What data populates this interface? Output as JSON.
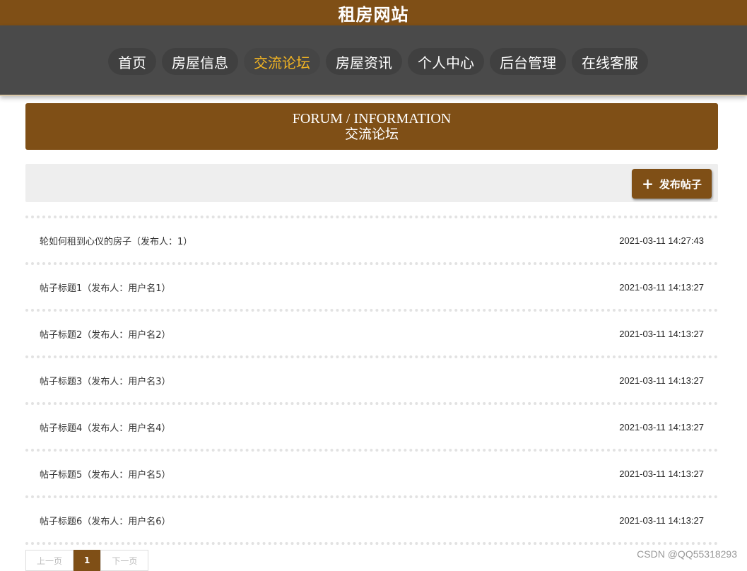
{
  "site": {
    "title": "租房网站"
  },
  "nav": {
    "items": [
      {
        "label": "首页"
      },
      {
        "label": "房屋信息"
      },
      {
        "label": "交流论坛",
        "active": true
      },
      {
        "label": "房屋资讯"
      },
      {
        "label": "个人中心"
      },
      {
        "label": "后台管理"
      },
      {
        "label": "在线客服"
      }
    ]
  },
  "section": {
    "title_en": "FORUM / INFORMATION",
    "title_zh": "交流论坛"
  },
  "toolbar": {
    "post_label": "发布帖子",
    "post_icon": "plus-icon"
  },
  "posts": [
    {
      "title": "轮如何租到心仪的房子（发布人：1）",
      "time": "2021-03-11 14:27:43"
    },
    {
      "title": "帖子标题1（发布人：用户名1）",
      "time": "2021-03-11 14:13:27"
    },
    {
      "title": "帖子标题2（发布人：用户名2）",
      "time": "2021-03-11 14:13:27"
    },
    {
      "title": "帖子标题3（发布人：用户名3）",
      "time": "2021-03-11 14:13:27"
    },
    {
      "title": "帖子标题4（发布人：用户名4）",
      "time": "2021-03-11 14:13:27"
    },
    {
      "title": "帖子标题5（发布人：用户名5）",
      "time": "2021-03-11 14:13:27"
    },
    {
      "title": "帖子标题6（发布人：用户名6）",
      "time": "2021-03-11 14:13:27"
    }
  ],
  "pager": {
    "prev": "上一页",
    "current": "1",
    "next": "下一页"
  },
  "watermark": "CSDN @QQ55318293",
  "colors": {
    "brand": "#7f4f16",
    "nav_bg": "#4a4a4a",
    "active": "#f0b323",
    "toolbar_bg": "#eeeeee"
  }
}
